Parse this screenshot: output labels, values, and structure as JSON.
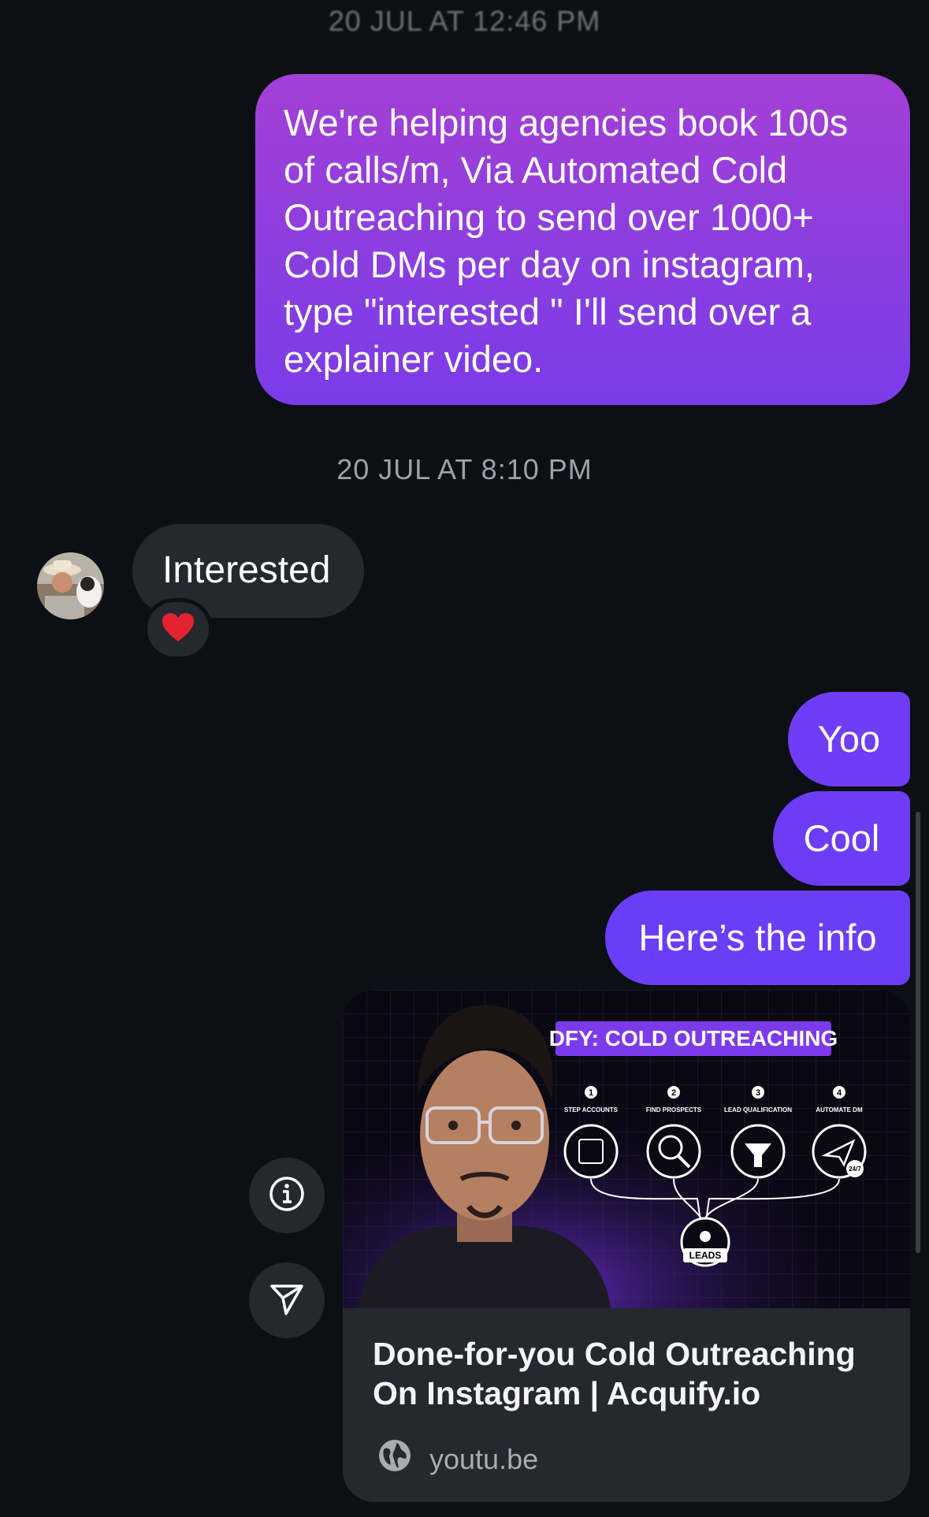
{
  "timestamps": {
    "first": "20 JUL AT 12:46 PM",
    "second": "20 JUL AT 8:10 PM"
  },
  "messages": {
    "pitch": "We're helping agencies book 100s of calls/m, Via Automated Cold Outreaching to send over 1000+ Cold DMs per day on instagram, type \"interested \" I'll send over a explainer video.",
    "reply": "Interested",
    "reaction": "❤️",
    "yoo": "Yoo",
    "cool": "Cool",
    "info": "Here’s the info"
  },
  "link_card": {
    "title": "Done-for-you Cold Outreaching On Instagram | Acquify.io",
    "source": "youtu.be",
    "thumbnail": {
      "banner": "DFY: COLD OUTREACHING",
      "steps": [
        {
          "num": "1",
          "label": "STEP ACCOUNTS"
        },
        {
          "num": "2",
          "label": "FIND PROSPECTS"
        },
        {
          "num": "3",
          "label": "LEAD QUALIFICATION"
        },
        {
          "num": "4",
          "label": "AUTOMATE DM"
        }
      ],
      "badge": "24/7",
      "result": "LEADS"
    }
  },
  "icons": {
    "info": "info-icon",
    "share": "send-icon",
    "source": "globe-icon"
  },
  "colors": {
    "background": "#0c0f14",
    "outgoing_bubble": "#6f3df5",
    "incoming_bubble": "#25282e",
    "timestamp": "#9ca1aa"
  }
}
